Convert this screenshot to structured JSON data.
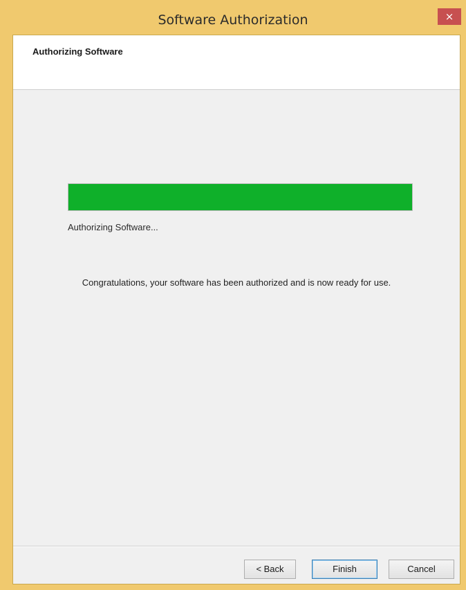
{
  "window": {
    "title": "Software Authorization",
    "close_label": "×"
  },
  "header": {
    "title": "Authorizing Software"
  },
  "progress": {
    "value_percent": 100,
    "fill_color": "#0fb02a",
    "label": "Authorizing Software..."
  },
  "message": "Congratulations, your software has been authorized and is now ready for use.",
  "buttons": {
    "back": "< Back",
    "finish": "Finish",
    "cancel": "Cancel"
  }
}
